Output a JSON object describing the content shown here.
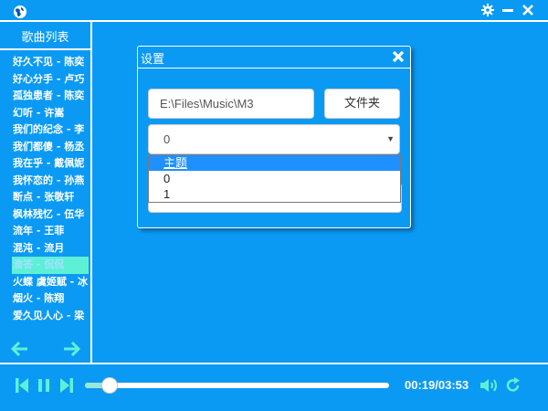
{
  "sidebar": {
    "title": "歌曲列表",
    "songs": [
      "好久不见 - 陈奕",
      "好心分手 - 卢巧",
      "孤独患者 - 陈奕",
      "幻听 - 许嵩",
      "我们的纪念 - 李",
      "我们都傻 - 杨丞",
      "我在乎 - 戴佩妮",
      "我怀恋的 - 孙燕",
      "断点 - 张敬轩",
      "枫林残忆 - 伍华",
      "流年 - 王菲",
      "混沌 - 流月",
      "滴答 - 侃侃",
      "火蝶 虞姬赋 - 冰",
      "烟火 - 陈翔",
      "爱久见人心 - 梁"
    ],
    "active_index": 12
  },
  "player": {
    "time": "00:19/03:53",
    "progress_fraction": 0.0815
  },
  "dialog": {
    "title": "设置",
    "path_value": "E:\\Files\\Music\\M3",
    "folder_button": "文件夹",
    "select_value": "0",
    "options": [
      "主题",
      "0",
      "1"
    ],
    "highlighted_option": 0
  },
  "colors": {
    "background": "#0a9af4",
    "accent": "#5ef0d6",
    "foreground": "#ffffff"
  }
}
